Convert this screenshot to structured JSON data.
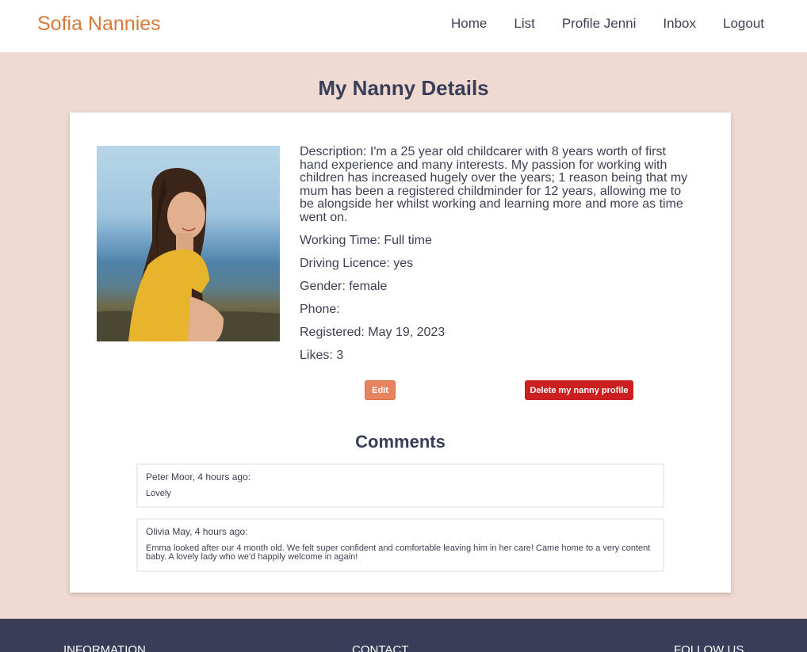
{
  "brand": "Sofia Nannies",
  "nav": [
    "Home",
    "List",
    "Profile Jenni",
    "Inbox",
    "Logout"
  ],
  "page_title": "My Nanny Details",
  "profile": {
    "description": "Description: I'm a 25 year old childcarer with 8 years worth of first hand experience and many interests. My passion for working with children has increased hugely over the years; 1 reason being that my mum has been a registered childminder for 12 years, allowing me to be alongside her whilst working and learning more and more as time went on.",
    "working_time": "Working Time: Full time",
    "driving_licence": "Driving Licence: yes",
    "gender": "Gender: female",
    "phone": "Phone:",
    "registered": "Registered: May 19, 2023",
    "likes": "Likes: 3"
  },
  "buttons": {
    "edit": "Edit",
    "delete": "Delete my nanny profile"
  },
  "comments_title": "Comments",
  "comments": [
    {
      "meta": "Peter Moor, 4 hours ago:",
      "body": "Lovely"
    },
    {
      "meta": "Olivia May, 4 hours ago:",
      "body": "Emma looked after our 4 month old. We felt super confident and comfortable leaving him in her care! Came home to a very content baby. A lovely lady who we'd happily welcome in again!"
    }
  ],
  "footer": {
    "information": "INFORMATION",
    "contact": "CONTACT",
    "follow_us": "FOLLOW US"
  },
  "colors": {
    "brand": "#d97a3a",
    "background": "#efd9d1",
    "footer": "#393e58",
    "edit": "#e8825f",
    "delete": "#cc1f1f"
  }
}
